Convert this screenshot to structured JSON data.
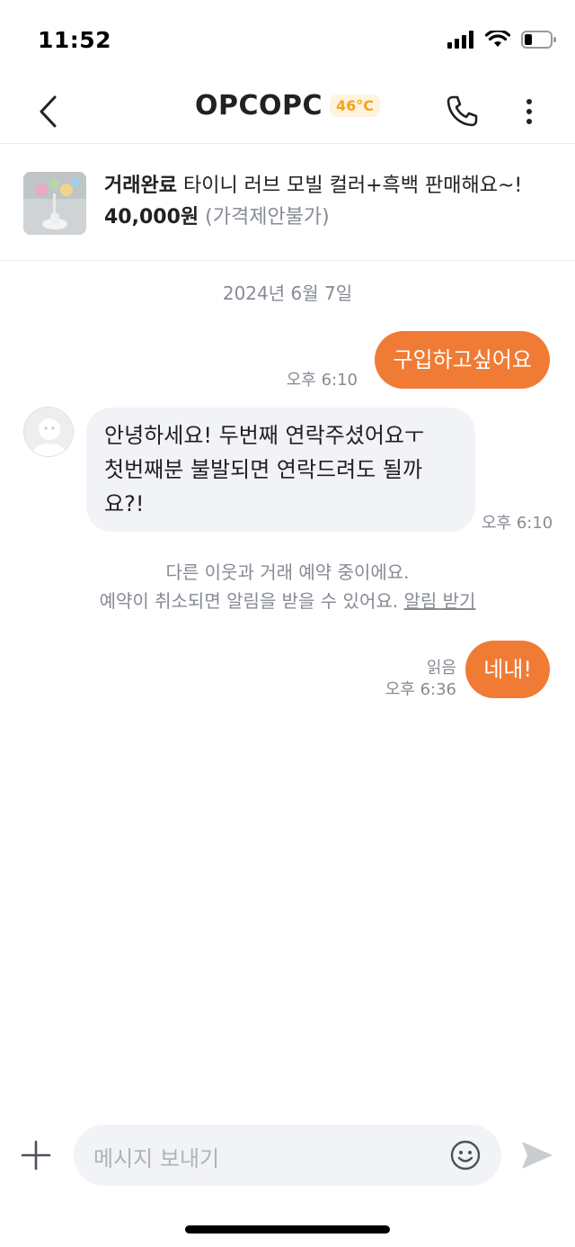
{
  "status_bar": {
    "time": "11:52"
  },
  "header": {
    "title": "OPCOPC",
    "temperature": "46°C"
  },
  "product": {
    "status": "거래완료",
    "name": "타이니 러브 모빌 컬러+흑백 판매해요~!",
    "price": "40,000원",
    "price_note": "(가격제안불가)"
  },
  "chat": {
    "date": "2024년 6월 7일",
    "messages": [
      {
        "side": "out",
        "text": "구입하고싶어요",
        "time": "오후 6:10"
      },
      {
        "side": "in",
        "text_lines": [
          "안녕하세요! 두번째 연락주셨어요ㅜ",
          "첫번째분 불발되면 연락드려도 될까",
          "요?!"
        ],
        "time": "오후 6:10"
      },
      {
        "side": "out",
        "text": "네내!",
        "time": "오후 6:36",
        "read": "읽음"
      }
    ],
    "system": {
      "line1": "다른 이웃과 거래 예약 중이에요.",
      "line2": "예약이 취소되면 알림을 받을 수 있어요.",
      "link": "알림 받기"
    }
  },
  "input": {
    "placeholder": "메시지 보내기"
  },
  "colors": {
    "accent": "#ef7b35",
    "temp_badge": "#f4a41b",
    "bubble_in": "#f2f3f6"
  },
  "icons": [
    "back-icon",
    "phone-icon",
    "more-vertical-icon",
    "plus-icon",
    "emoji-icon",
    "send-icon"
  ]
}
